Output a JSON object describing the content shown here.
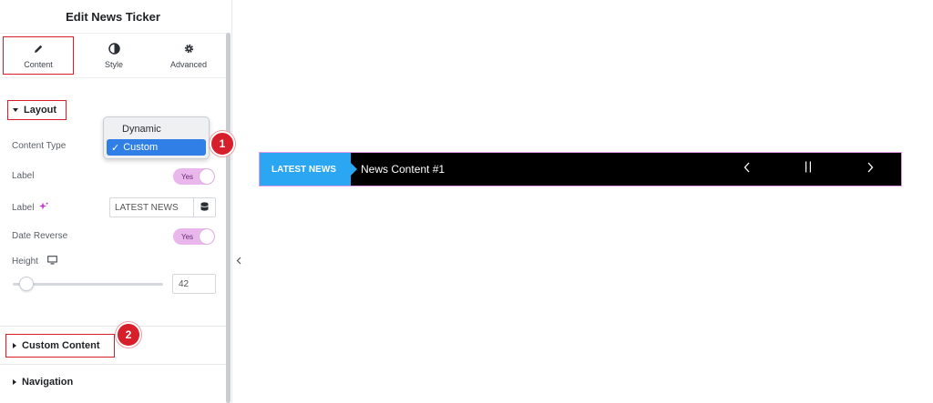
{
  "panel": {
    "title": "Edit News Ticker",
    "tabs": [
      {
        "label": "Content",
        "icon": "pencil-icon",
        "active": true
      },
      {
        "label": "Style",
        "icon": "contrast-icon",
        "active": false
      },
      {
        "label": "Advanced",
        "icon": "gear-icon",
        "active": false
      }
    ]
  },
  "layout": {
    "section_title": "Layout",
    "content_type_label": "Content Type",
    "label_toggle_label": "Label",
    "label_toggle_value": "Yes",
    "label_text_label": "Label",
    "label_text_value": "LATEST NEWS",
    "date_reverse_label": "Date Reverse",
    "date_reverse_value": "Yes",
    "height_label": "Height",
    "height_value": "42",
    "height_slider_value": 42
  },
  "dropdown": {
    "options": [
      "Dynamic",
      "Custom"
    ],
    "selected": "Custom",
    "check": "✓"
  },
  "sections": {
    "custom_content": "Custom Content",
    "navigation": "Navigation"
  },
  "badges": {
    "one": "1",
    "two": "2"
  },
  "ticker": {
    "label": "LATEST NEWS",
    "content": "News Content #1",
    "prev": "‹",
    "pause": "||",
    "next": "›"
  },
  "colors": {
    "accent_red": "#d61f2a",
    "toggle_on": "#e9b7ec",
    "ticker_label_bg": "#2ba6f2",
    "ticker_bg": "#000000",
    "dropdown_selected": "#2f7fe6"
  }
}
